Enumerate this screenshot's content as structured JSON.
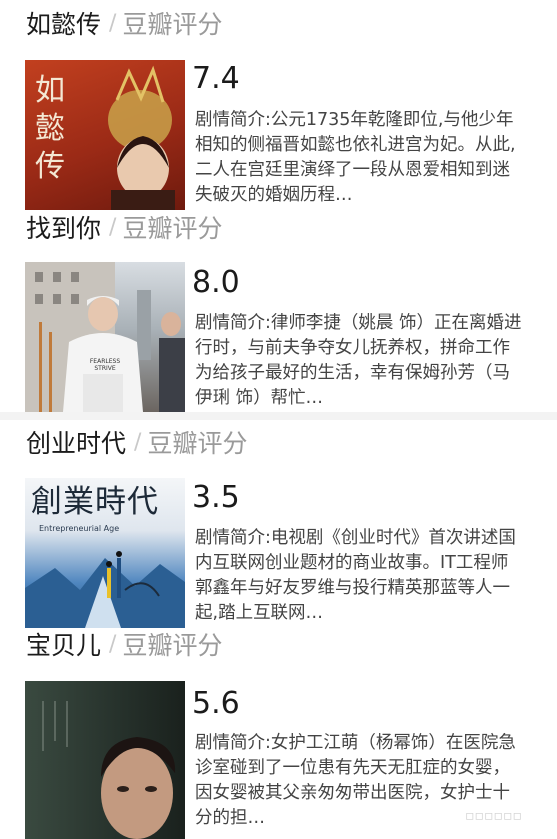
{
  "source_label": "豆瓣评分",
  "cards": [
    {
      "title": "如懿传",
      "score": "7.4",
      "desc": "剧情简介:公元1735年乾隆即位,与他少年相知的侧福晋如懿也依礼进宫为妃。从此,二人在宫廷里演绎了一段从恩爱相知到迷失破灭的婚姻历程…",
      "poster_text": "如懿传",
      "colors": {
        "poster_bg": "#b2341e"
      }
    },
    {
      "title": "找到你",
      "score": "8.0",
      "desc": "剧情简介:律师李捷（姚晨 饰）正在离婚进行时，与前夫争夺女儿抚养权，拼命工作为给孩子最好的生活，幸有保姆孙芳（马伊琍 饰）帮忙…",
      "poster_text": "FEARLESS STRIVE",
      "colors": {
        "poster_bg": "#8e9aa2"
      }
    },
    {
      "title": "创业时代",
      "score": "3.5",
      "desc": "剧情简介:电视剧《创业时代》首次讲述国内互联网创业题材的商业故事。IT工程师郭鑫年与好友罗维与投行精英那蓝等人一起,踏上互联网…",
      "poster_text": "創業時代",
      "poster_subtext": "Entrepreneurial Age",
      "colors": {
        "poster_bg": "#3b6ea3"
      }
    },
    {
      "title": "宝贝儿",
      "score": "5.6",
      "desc": "剧情简介:女护工江萌（杨幂饰）在医院急诊室碰到了一位患有先天无肛症的女婴，因女婴被其父亲匆匆带出医院，女护士十分的担…",
      "colors": {
        "poster_bg": "#2f3b33"
      }
    }
  ]
}
